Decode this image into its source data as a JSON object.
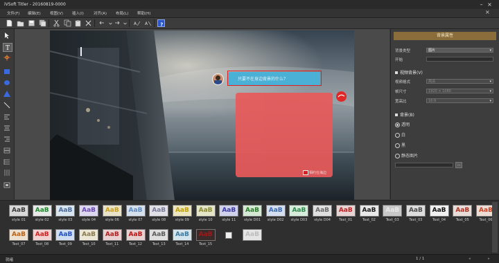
{
  "window": {
    "title": "iVSoft Titler - 20160819-0000",
    "menus": [
      "文件(F)",
      "编辑(E)",
      "视图(V)",
      "插入(I)",
      "对齐(A)",
      "布局(L)",
      "帮助(H)"
    ]
  },
  "canvas": {
    "chat_text": "只要不在身边背景的什么？",
    "sticker_text": "相约在海边"
  },
  "properties": {
    "panel_title": "背景属性",
    "row1_label": "背景类型",
    "row1_value": "图片",
    "row2_label": "开始",
    "video_section": "视频背景(V)",
    "vb_row1_label": "视频格式",
    "vb_row1_value": "高清",
    "vb_row2_label": "帧尺寸",
    "vb_row2_value": "1920 × 1080",
    "vb_row3_label": "宽高比",
    "vb_row3_value": "16:9",
    "bg_section": "背景(B)",
    "radio_1": "透明",
    "radio_2": "白",
    "radio_3": "黑",
    "radio_4": "静态图片",
    "browse_label": "..."
  },
  "styles": [
    {
      "name": "style 01",
      "fg": "#3a3a3a",
      "bg": "#d8d8d8"
    },
    {
      "name": "style 02",
      "fg": "#1e8a2a",
      "bg": "#e8e8e8"
    },
    {
      "name": "style 03",
      "fg": "#4a6a9a",
      "bg": "#d8e4ee"
    },
    {
      "name": "style 04",
      "fg": "#6a4ab0",
      "bg": "#dcd6ee"
    },
    {
      "name": "style 06",
      "fg": "#c8a020",
      "bg": "#e8e2c8"
    },
    {
      "name": "style 07",
      "fg": "#5a8ac0",
      "bg": "#d6e0ec"
    },
    {
      "name": "style 08",
      "fg": "#7a7a9a",
      "bg": "#e0e0e6"
    },
    {
      "name": "style 09",
      "fg": "#c0a000",
      "bg": "#ece6c0"
    },
    {
      "name": "style 10",
      "fg": "#8a8a30",
      "bg": "#e4e4c8"
    },
    {
      "name": "style 11",
      "fg": "#3a3aa0",
      "bg": "#cfd0ea"
    },
    {
      "name": "style D01",
      "fg": "#2a7a2a",
      "bg": "#d4e8d4"
    },
    {
      "name": "style D02",
      "fg": "#3a6ab0",
      "bg": "#d4deee"
    },
    {
      "name": "style D03",
      "fg": "#2a8a4a",
      "bg": "#d8ecdc"
    },
    {
      "name": "style D04",
      "fg": "#6a6a6a",
      "bg": "#e0e0e0"
    },
    {
      "name": "Text_01",
      "fg": "#c02020",
      "bg": "#e6d4d4"
    },
    {
      "name": "Text_02",
      "fg": "#1a1a1a",
      "bg": "#e8e8e8"
    },
    {
      "name": "Text_03",
      "fg": "#e8e8e8",
      "bg": "#c8c8c8"
    },
    {
      "name": "Text_03",
      "fg": "#4a4a4a",
      "bg": "#dcdcdc"
    },
    {
      "name": "Text_04",
      "fg": "#111111",
      "bg": "#f0f0f0"
    },
    {
      "name": "Text_05",
      "fg": "#b03020",
      "bg": "#e8dcd8"
    },
    {
      "name": "Text_06",
      "fg": "#d04020",
      "bg": "#ecdcd4"
    },
    {
      "name": "Text_07",
      "fg": "#c06010",
      "bg": "#ece0d0"
    },
    {
      "name": "Text_08",
      "fg": "#d02020",
      "bg": "#f0d0d0"
    },
    {
      "name": "Text_09",
      "fg": "#2050c0",
      "bg": "#d0dcf0"
    },
    {
      "name": "Text_10",
      "fg": "#8a7a50",
      "bg": "#ece6d4"
    },
    {
      "name": "Text_11",
      "fg": "#b02020",
      "bg": "#e8d0d0"
    },
    {
      "name": "Text_12",
      "fg": "#c01010",
      "bg": "#e6d0d0"
    },
    {
      "name": "Text_13",
      "fg": "#5a5a5a",
      "bg": "#dedede"
    },
    {
      "name": "Text_14",
      "fg": "#3a7aa0",
      "bg": "#d4e4ec"
    },
    {
      "name": "Text_15",
      "fg": "#a01818",
      "bg": "#3a2a2a"
    },
    {
      "name": "",
      "fg": "#222222",
      "bg": "#eeeeee"
    },
    {
      "name": "AaB",
      "fg": "#bdbdbd",
      "bg": "#e4e4e4"
    }
  ],
  "style_sample": "AaB",
  "status": {
    "left": "就绪",
    "page": "1 / 1"
  },
  "colors": {
    "selection": "#e02020",
    "chat_bubble": "#4ab0d6",
    "sticker": "#e85a5a",
    "panel_header": "#8a6d3a"
  }
}
